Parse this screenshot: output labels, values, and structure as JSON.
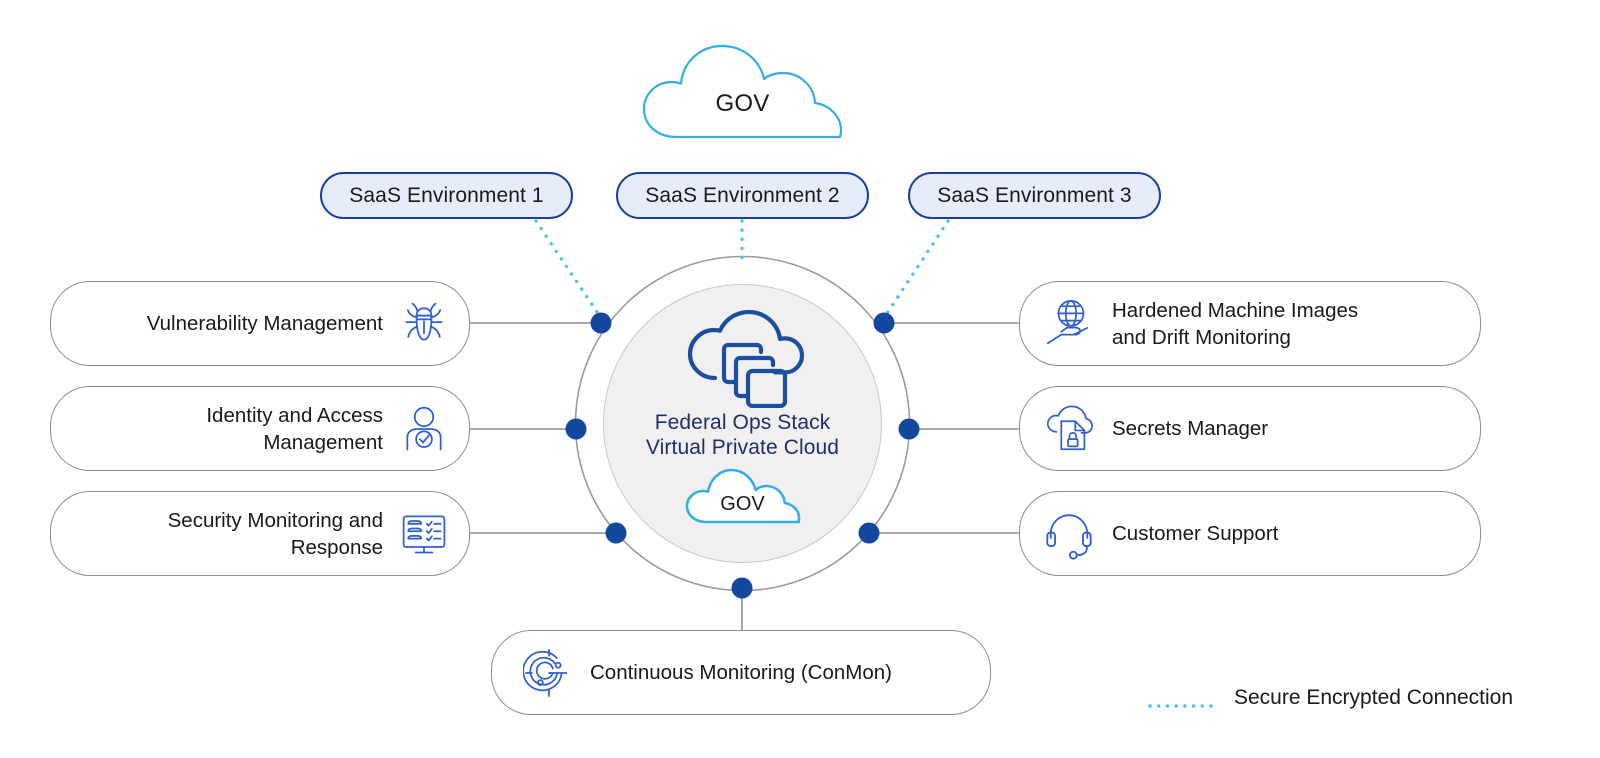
{
  "colors": {
    "accent_blue": "#1b5aad",
    "icon_blue": "#2f5fd0",
    "pill_border": "#1a3fa0",
    "pill_fill": "#e6ecf9",
    "cloud_outline": "#35aee6",
    "dot_navy": "#14489e",
    "hub_fill": "#f0f0f0",
    "hub_ring": "#9b9b9b",
    "panel_border": "#8d8d8d",
    "hub_text": "#1f2f66",
    "body_text": "#1a1a1a",
    "dotted_line": "#4cc2f1"
  },
  "top_cloud": {
    "label": "GOV",
    "icon": "cloud-outline-icon"
  },
  "saas_environments": [
    {
      "label": "SaaS Environment 1"
    },
    {
      "label": "SaaS Environment 2"
    },
    {
      "label": "SaaS Environment 3"
    }
  ],
  "hub": {
    "icon": "cloud-with-stacked-layers-icon",
    "title_line1": "Federal Ops Stack",
    "title_line2": "Virtual Private Cloud",
    "badge": {
      "label": "GOV",
      "icon": "cloud-outline-icon"
    }
  },
  "panels_left": [
    {
      "label": "Vulnerability Management",
      "icon": "bug-icon"
    },
    {
      "label": "Identity and Access\nManagement",
      "icon": "user-verified-icon"
    },
    {
      "label": "Security Monitoring and\nResponse",
      "icon": "monitor-checklist-icon"
    }
  ],
  "panels_right": [
    {
      "label": "Hardened Machine Images\nand Drift Monitoring",
      "icon": "globe-in-hand-icon"
    },
    {
      "label": "Secrets Manager",
      "icon": "cloud-locked-document-icon"
    },
    {
      "label": "Customer Support",
      "icon": "headset-icon"
    }
  ],
  "panels_bottom": [
    {
      "label": "Continuous Monitoring (ConMon)",
      "icon": "radar-monitoring-icon"
    }
  ],
  "legend": {
    "label": "Secure Encrypted Connection",
    "line_style": "dotted",
    "color": "#4cc2f1"
  }
}
